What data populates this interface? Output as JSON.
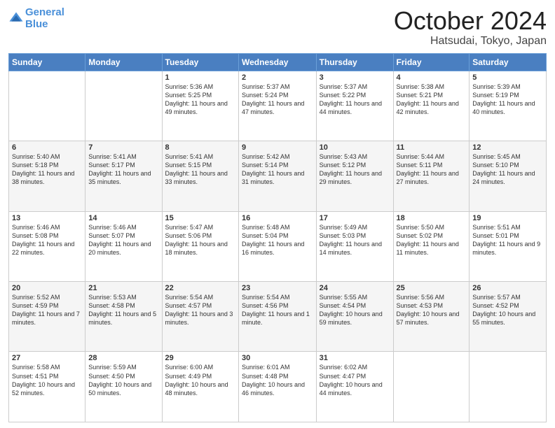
{
  "header": {
    "logo_line1": "General",
    "logo_line2": "Blue",
    "month": "October 2024",
    "location": "Hatsudai, Tokyo, Japan"
  },
  "weekdays": [
    "Sunday",
    "Monday",
    "Tuesday",
    "Wednesday",
    "Thursday",
    "Friday",
    "Saturday"
  ],
  "weeks": [
    [
      {
        "day": "",
        "sunrise": "",
        "sunset": "",
        "daylight": ""
      },
      {
        "day": "",
        "sunrise": "",
        "sunset": "",
        "daylight": ""
      },
      {
        "day": "1",
        "sunrise": "Sunrise: 5:36 AM",
        "sunset": "Sunset: 5:25 PM",
        "daylight": "Daylight: 11 hours and 49 minutes."
      },
      {
        "day": "2",
        "sunrise": "Sunrise: 5:37 AM",
        "sunset": "Sunset: 5:24 PM",
        "daylight": "Daylight: 11 hours and 47 minutes."
      },
      {
        "day": "3",
        "sunrise": "Sunrise: 5:37 AM",
        "sunset": "Sunset: 5:22 PM",
        "daylight": "Daylight: 11 hours and 44 minutes."
      },
      {
        "day": "4",
        "sunrise": "Sunrise: 5:38 AM",
        "sunset": "Sunset: 5:21 PM",
        "daylight": "Daylight: 11 hours and 42 minutes."
      },
      {
        "day": "5",
        "sunrise": "Sunrise: 5:39 AM",
        "sunset": "Sunset: 5:19 PM",
        "daylight": "Daylight: 11 hours and 40 minutes."
      }
    ],
    [
      {
        "day": "6",
        "sunrise": "Sunrise: 5:40 AM",
        "sunset": "Sunset: 5:18 PM",
        "daylight": "Daylight: 11 hours and 38 minutes."
      },
      {
        "day": "7",
        "sunrise": "Sunrise: 5:41 AM",
        "sunset": "Sunset: 5:17 PM",
        "daylight": "Daylight: 11 hours and 35 minutes."
      },
      {
        "day": "8",
        "sunrise": "Sunrise: 5:41 AM",
        "sunset": "Sunset: 5:15 PM",
        "daylight": "Daylight: 11 hours and 33 minutes."
      },
      {
        "day": "9",
        "sunrise": "Sunrise: 5:42 AM",
        "sunset": "Sunset: 5:14 PM",
        "daylight": "Daylight: 11 hours and 31 minutes."
      },
      {
        "day": "10",
        "sunrise": "Sunrise: 5:43 AM",
        "sunset": "Sunset: 5:12 PM",
        "daylight": "Daylight: 11 hours and 29 minutes."
      },
      {
        "day": "11",
        "sunrise": "Sunrise: 5:44 AM",
        "sunset": "Sunset: 5:11 PM",
        "daylight": "Daylight: 11 hours and 27 minutes."
      },
      {
        "day": "12",
        "sunrise": "Sunrise: 5:45 AM",
        "sunset": "Sunset: 5:10 PM",
        "daylight": "Daylight: 11 hours and 24 minutes."
      }
    ],
    [
      {
        "day": "13",
        "sunrise": "Sunrise: 5:46 AM",
        "sunset": "Sunset: 5:08 PM",
        "daylight": "Daylight: 11 hours and 22 minutes."
      },
      {
        "day": "14",
        "sunrise": "Sunrise: 5:46 AM",
        "sunset": "Sunset: 5:07 PM",
        "daylight": "Daylight: 11 hours and 20 minutes."
      },
      {
        "day": "15",
        "sunrise": "Sunrise: 5:47 AM",
        "sunset": "Sunset: 5:06 PM",
        "daylight": "Daylight: 11 hours and 18 minutes."
      },
      {
        "day": "16",
        "sunrise": "Sunrise: 5:48 AM",
        "sunset": "Sunset: 5:04 PM",
        "daylight": "Daylight: 11 hours and 16 minutes."
      },
      {
        "day": "17",
        "sunrise": "Sunrise: 5:49 AM",
        "sunset": "Sunset: 5:03 PM",
        "daylight": "Daylight: 11 hours and 14 minutes."
      },
      {
        "day": "18",
        "sunrise": "Sunrise: 5:50 AM",
        "sunset": "Sunset: 5:02 PM",
        "daylight": "Daylight: 11 hours and 11 minutes."
      },
      {
        "day": "19",
        "sunrise": "Sunrise: 5:51 AM",
        "sunset": "Sunset: 5:01 PM",
        "daylight": "Daylight: 11 hours and 9 minutes."
      }
    ],
    [
      {
        "day": "20",
        "sunrise": "Sunrise: 5:52 AM",
        "sunset": "Sunset: 4:59 PM",
        "daylight": "Daylight: 11 hours and 7 minutes."
      },
      {
        "day": "21",
        "sunrise": "Sunrise: 5:53 AM",
        "sunset": "Sunset: 4:58 PM",
        "daylight": "Daylight: 11 hours and 5 minutes."
      },
      {
        "day": "22",
        "sunrise": "Sunrise: 5:54 AM",
        "sunset": "Sunset: 4:57 PM",
        "daylight": "Daylight: 11 hours and 3 minutes."
      },
      {
        "day": "23",
        "sunrise": "Sunrise: 5:54 AM",
        "sunset": "Sunset: 4:56 PM",
        "daylight": "Daylight: 11 hours and 1 minute."
      },
      {
        "day": "24",
        "sunrise": "Sunrise: 5:55 AM",
        "sunset": "Sunset: 4:54 PM",
        "daylight": "Daylight: 10 hours and 59 minutes."
      },
      {
        "day": "25",
        "sunrise": "Sunrise: 5:56 AM",
        "sunset": "Sunset: 4:53 PM",
        "daylight": "Daylight: 10 hours and 57 minutes."
      },
      {
        "day": "26",
        "sunrise": "Sunrise: 5:57 AM",
        "sunset": "Sunset: 4:52 PM",
        "daylight": "Daylight: 10 hours and 55 minutes."
      }
    ],
    [
      {
        "day": "27",
        "sunrise": "Sunrise: 5:58 AM",
        "sunset": "Sunset: 4:51 PM",
        "daylight": "Daylight: 10 hours and 52 minutes."
      },
      {
        "day": "28",
        "sunrise": "Sunrise: 5:59 AM",
        "sunset": "Sunset: 4:50 PM",
        "daylight": "Daylight: 10 hours and 50 minutes."
      },
      {
        "day": "29",
        "sunrise": "Sunrise: 6:00 AM",
        "sunset": "Sunset: 4:49 PM",
        "daylight": "Daylight: 10 hours and 48 minutes."
      },
      {
        "day": "30",
        "sunrise": "Sunrise: 6:01 AM",
        "sunset": "Sunset: 4:48 PM",
        "daylight": "Daylight: 10 hours and 46 minutes."
      },
      {
        "day": "31",
        "sunrise": "Sunrise: 6:02 AM",
        "sunset": "Sunset: 4:47 PM",
        "daylight": "Daylight: 10 hours and 44 minutes."
      },
      {
        "day": "",
        "sunrise": "",
        "sunset": "",
        "daylight": ""
      },
      {
        "day": "",
        "sunrise": "",
        "sunset": "",
        "daylight": ""
      }
    ]
  ]
}
